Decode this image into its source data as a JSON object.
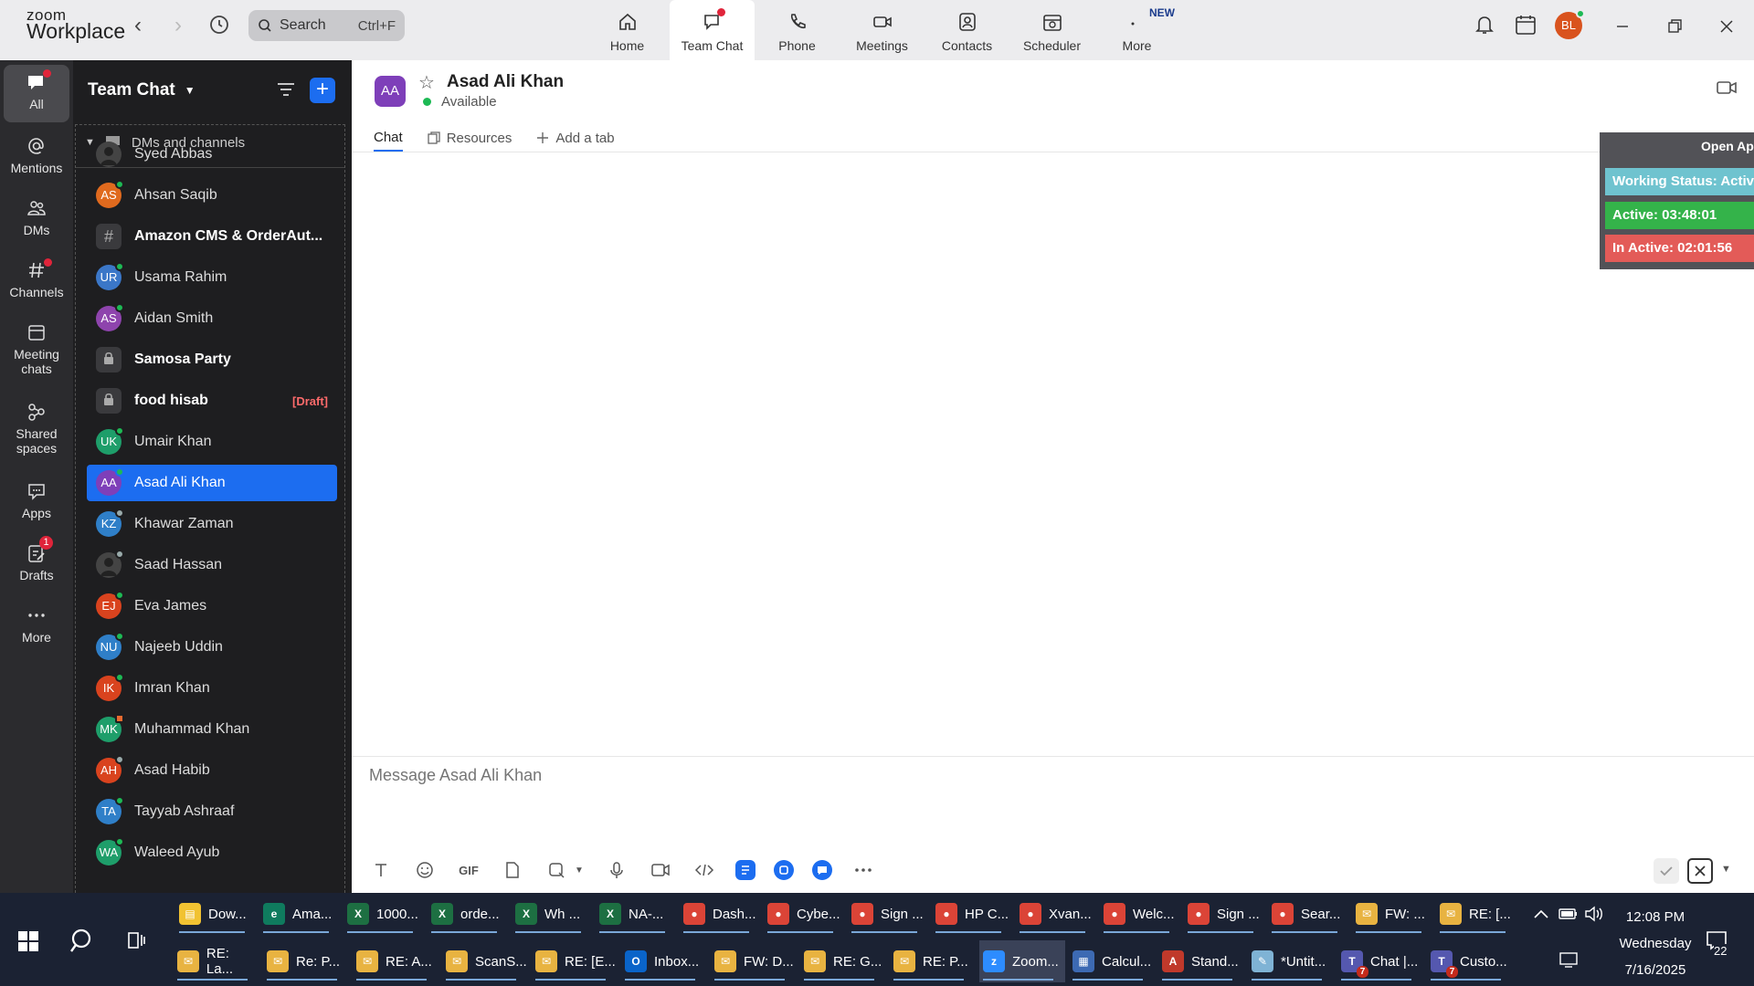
{
  "app": {
    "logo_line1": "zoom",
    "logo_line2": "Workplace"
  },
  "search": {
    "placeholder": "Search",
    "shortcut": "Ctrl+F"
  },
  "topnav": [
    {
      "label": "Home"
    },
    {
      "label": "Team Chat"
    },
    {
      "label": "Phone"
    },
    {
      "label": "Meetings"
    },
    {
      "label": "Contacts"
    },
    {
      "label": "Scheduler"
    },
    {
      "label": "More",
      "badge": "NEW"
    }
  ],
  "user": {
    "initials": "BL"
  },
  "rail": [
    {
      "label": "All"
    },
    {
      "label": "Mentions"
    },
    {
      "label": "DMs"
    },
    {
      "label": "Channels"
    },
    {
      "label": "Meeting chats"
    },
    {
      "label": "Shared spaces"
    },
    {
      "label": "Apps"
    },
    {
      "label": "Drafts",
      "badge": "1"
    },
    {
      "label": "More"
    }
  ],
  "chatlist": {
    "title": "Team Chat",
    "section": "DMs and channels",
    "items": [
      {
        "initials": "",
        "name": "Syed Abbas"
      },
      {
        "initials": "AS",
        "name": "Ahsan Saqib"
      },
      {
        "initials": "#",
        "name": "Amazon CMS & OrderAut..."
      },
      {
        "initials": "UR",
        "name": "Usama Rahim"
      },
      {
        "initials": "AS",
        "name": "Aidan Smith"
      },
      {
        "initials": "",
        "name": "Samosa Party"
      },
      {
        "initials": "",
        "name": "food hisab",
        "draft": "[Draft]"
      },
      {
        "initials": "UK",
        "name": "Umair Khan"
      },
      {
        "initials": "AA",
        "name": "Asad Ali Khan"
      },
      {
        "initials": "KZ",
        "name": "Khawar Zaman"
      },
      {
        "initials": "",
        "name": "Saad Hassan"
      },
      {
        "initials": "EJ",
        "name": "Eva James"
      },
      {
        "initials": "NU",
        "name": "Najeeb Uddin"
      },
      {
        "initials": "IK",
        "name": "Imran Khan"
      },
      {
        "initials": "MK",
        "name": "Muhammad Khan"
      },
      {
        "initials": "AH",
        "name": "Asad Habib"
      },
      {
        "initials": "TA",
        "name": "Tayyab Ashraaf"
      },
      {
        "initials": "WA",
        "name": "Waleed Ayub"
      }
    ]
  },
  "conversation": {
    "initials": "AA",
    "name": "Asad Ali Khan",
    "status": "Available",
    "tabs": [
      "Chat",
      "Resources",
      "Add a tab"
    ],
    "composer_placeholder": "Message Asad Ali Khan",
    "toolbar": {
      "gif": "GIF"
    }
  },
  "overlay": {
    "open_label": "Open Ap",
    "working_status": "Working Status: Activ",
    "active": "Active: 03:48:01",
    "inactive": "In Active: 02:01:56"
  },
  "taskbar": {
    "row1": [
      "Dow...",
      "Ama...",
      "1000...",
      "orde...",
      "Wh ...",
      "NA-...",
      "Dash...",
      "Cybe...",
      "Sign ...",
      "HP C...",
      "Xvan...",
      "Welc...",
      "Sign ...",
      "Sear...",
      "FW: ...",
      "RE: [..."
    ],
    "row2": [
      "RE: La...",
      "Re: P...",
      "RE: A...",
      "ScanS...",
      "RE: [E...",
      "Inbox...",
      "FW: D...",
      "RE: G...",
      "RE: P...",
      "Zoom...",
      "Calcul...",
      "Stand...",
      "*Untit...",
      "Chat |...",
      "Custo..."
    ],
    "teams_badge": "7",
    "time": "12:08 PM",
    "day": "Wednesday",
    "date": "7/16/2025",
    "notifications": "22"
  },
  "colors": {
    "accent": "#1c6df0",
    "rail_bg": "#2b2b2e",
    "list_bg": "#1e1e20",
    "working_status": "#6fc3cf",
    "active": "#34b34a",
    "inactive": "#e35b58",
    "taskbar": "#1b2233"
  }
}
